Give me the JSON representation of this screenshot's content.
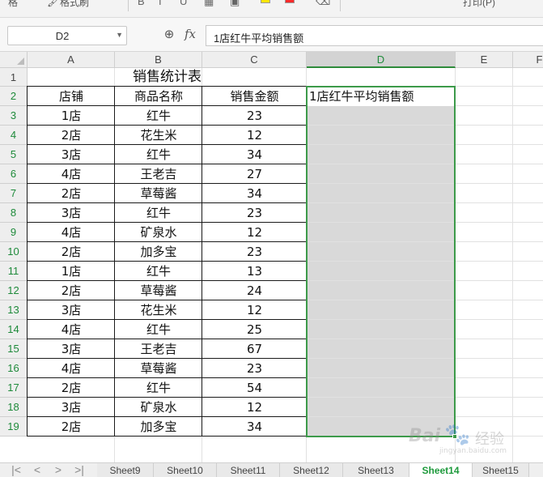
{
  "toolbar": {
    "fragments": [
      "格",
      "格式刷",
      "打印(P)"
    ]
  },
  "formula_bar": {
    "cell_ref": "D2",
    "fx_label": "fx",
    "formula": "1店红牛平均销售额"
  },
  "columns": [
    "A",
    "B",
    "C",
    "D",
    "E",
    "F"
  ],
  "rows": [
    "1",
    "2",
    "3",
    "4",
    "5",
    "6",
    "7",
    "8",
    "9",
    "10",
    "11",
    "12",
    "13",
    "14",
    "15",
    "16",
    "17",
    "18",
    "19"
  ],
  "sheet": {
    "title": "销售统计表",
    "headers": [
      "店铺",
      "商品名称",
      "销售金额"
    ],
    "d2_label": "1店红牛平均销售额",
    "data": [
      [
        "1店",
        "红牛",
        "23"
      ],
      [
        "2店",
        "花生米",
        "12"
      ],
      [
        "3店",
        "红牛",
        "34"
      ],
      [
        "4店",
        "王老吉",
        "27"
      ],
      [
        "2店",
        "草莓酱",
        "34"
      ],
      [
        "3店",
        "红牛",
        "23"
      ],
      [
        "4店",
        "矿泉水",
        "12"
      ],
      [
        "2店",
        "加多宝",
        "23"
      ],
      [
        "1店",
        "红牛",
        "13"
      ],
      [
        "2店",
        "草莓酱",
        "24"
      ],
      [
        "3店",
        "花生米",
        "12"
      ],
      [
        "4店",
        "红牛",
        "25"
      ],
      [
        "3店",
        "王老吉",
        "67"
      ],
      [
        "4店",
        "草莓酱",
        "23"
      ],
      [
        "2店",
        "红牛",
        "54"
      ],
      [
        "3店",
        "矿泉水",
        "12"
      ],
      [
        "2店",
        "加多宝",
        "34"
      ]
    ]
  },
  "tabs": [
    "Sheet9",
    "Sheet10",
    "Sheet11",
    "Sheet12",
    "Sheet13",
    "Sheet14",
    "Sheet15"
  ],
  "active_tab": "Sheet14",
  "nav": [
    "first-icon",
    "prev-icon",
    "next-icon",
    "last-icon"
  ],
  "watermark": {
    "brand": "Bai",
    "brand2": "经验",
    "sub": "jingyan.baidu.com"
  },
  "colors": {
    "accent_green": "#3d9a4a",
    "selected_fill": "#d9d9d9",
    "header_bg": "#eeeeee"
  }
}
